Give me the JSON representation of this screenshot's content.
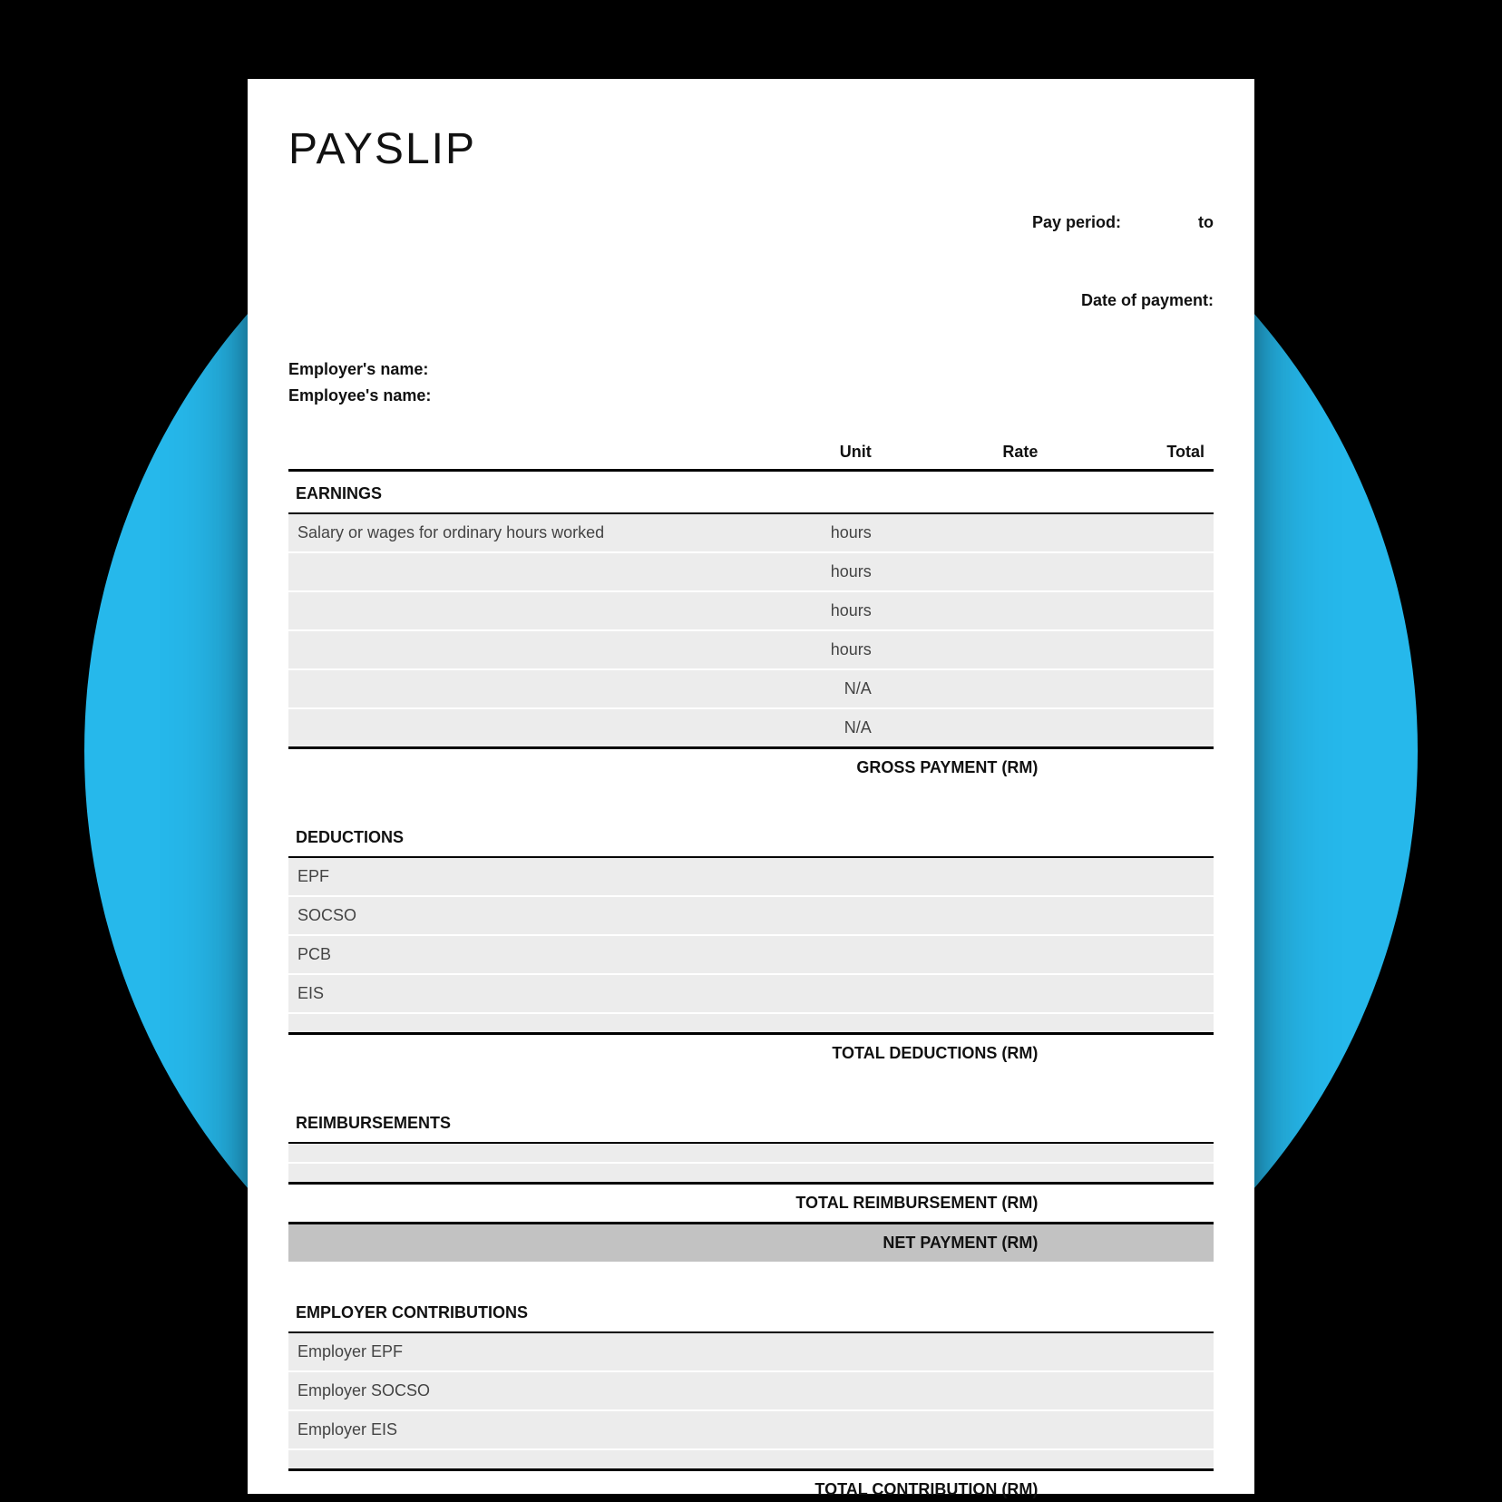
{
  "title": "PAYSLIP",
  "meta": {
    "pay_period_label": "Pay period:",
    "pay_period_to": "to",
    "date_of_payment_label": "Date of payment:"
  },
  "names": {
    "employer_label": "Employer's name:",
    "employee_label": "Employee's name:"
  },
  "columns": {
    "unit": "Unit",
    "rate": "Rate",
    "total": "Total"
  },
  "earnings": {
    "header": "EARNINGS",
    "rows": [
      {
        "desc": "Salary or wages for ordinary hours worked",
        "unit": "hours"
      },
      {
        "desc": "",
        "unit": "hours"
      },
      {
        "desc": "",
        "unit": "hours"
      },
      {
        "desc": "",
        "unit": "hours"
      },
      {
        "desc": "",
        "unit": "N/A"
      },
      {
        "desc": "",
        "unit": "N/A"
      }
    ],
    "sum_label": "GROSS PAYMENT  (RM)"
  },
  "deductions": {
    "header": "DEDUCTIONS",
    "rows": [
      {
        "desc": "EPF"
      },
      {
        "desc": "SOCSO"
      },
      {
        "desc": "PCB"
      },
      {
        "desc": "EIS"
      },
      {
        "desc": ""
      }
    ],
    "sum_label": "TOTAL DEDUCTIONS (RM)"
  },
  "reimbursements": {
    "header": "REIMBURSEMENTS",
    "rows": [
      {
        "desc": ""
      },
      {
        "desc": ""
      }
    ],
    "sum_label": "TOTAL REIMBURSEMENT (RM)",
    "net_label": "NET PAYMENT (RM)"
  },
  "employer_contributions": {
    "header": "EMPLOYER CONTRIBUTIONS",
    "rows": [
      {
        "desc": "Employer EPF"
      },
      {
        "desc": "Employer SOCSO"
      },
      {
        "desc": "Employer EIS"
      },
      {
        "desc": ""
      }
    ],
    "sum_label": "TOTAL CONTRIBUTION (RM)"
  }
}
